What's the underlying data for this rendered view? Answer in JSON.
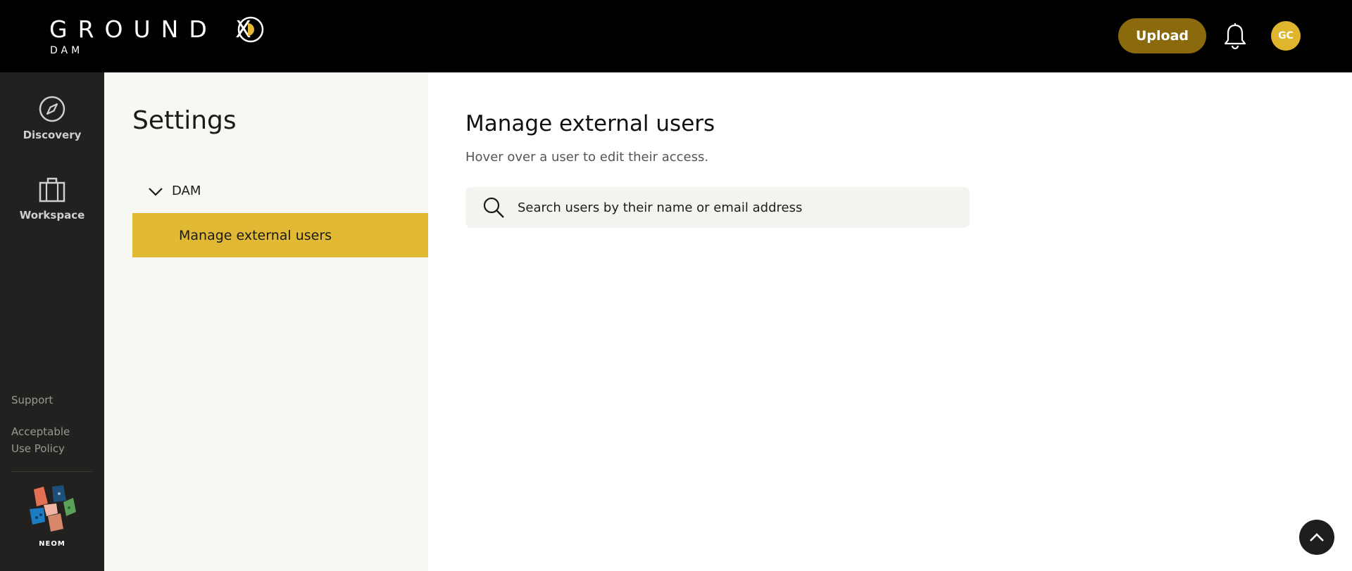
{
  "header": {
    "logo_text": "GROUND X",
    "logo_subtext": "DAM",
    "upload_label": "Upload",
    "avatar_initials": "GC",
    "colors": {
      "background": "#000000",
      "upload": "#8a6a0c",
      "avatar": "#dfb52d",
      "accent": "#e2b935"
    }
  },
  "rail": {
    "items": [
      {
        "label": "Discovery",
        "icon": "compass-icon"
      },
      {
        "label": "Workspace",
        "icon": "briefcase-icon"
      }
    ],
    "links": [
      {
        "label": "Support"
      },
      {
        "label": "Acceptable Use Policy"
      }
    ],
    "brand_label": "NEOM"
  },
  "settings": {
    "title": "Settings",
    "section": {
      "label": "DAM",
      "icon": "chevron-down-icon"
    },
    "active_item": "Manage external users"
  },
  "main": {
    "title": "Manage external users",
    "subtitle": "Hover over a user to edit their access.",
    "search_placeholder": "Search users by their name or email address",
    "search_value": ""
  },
  "scroll_top": {
    "icon": "chevron-up-icon"
  }
}
